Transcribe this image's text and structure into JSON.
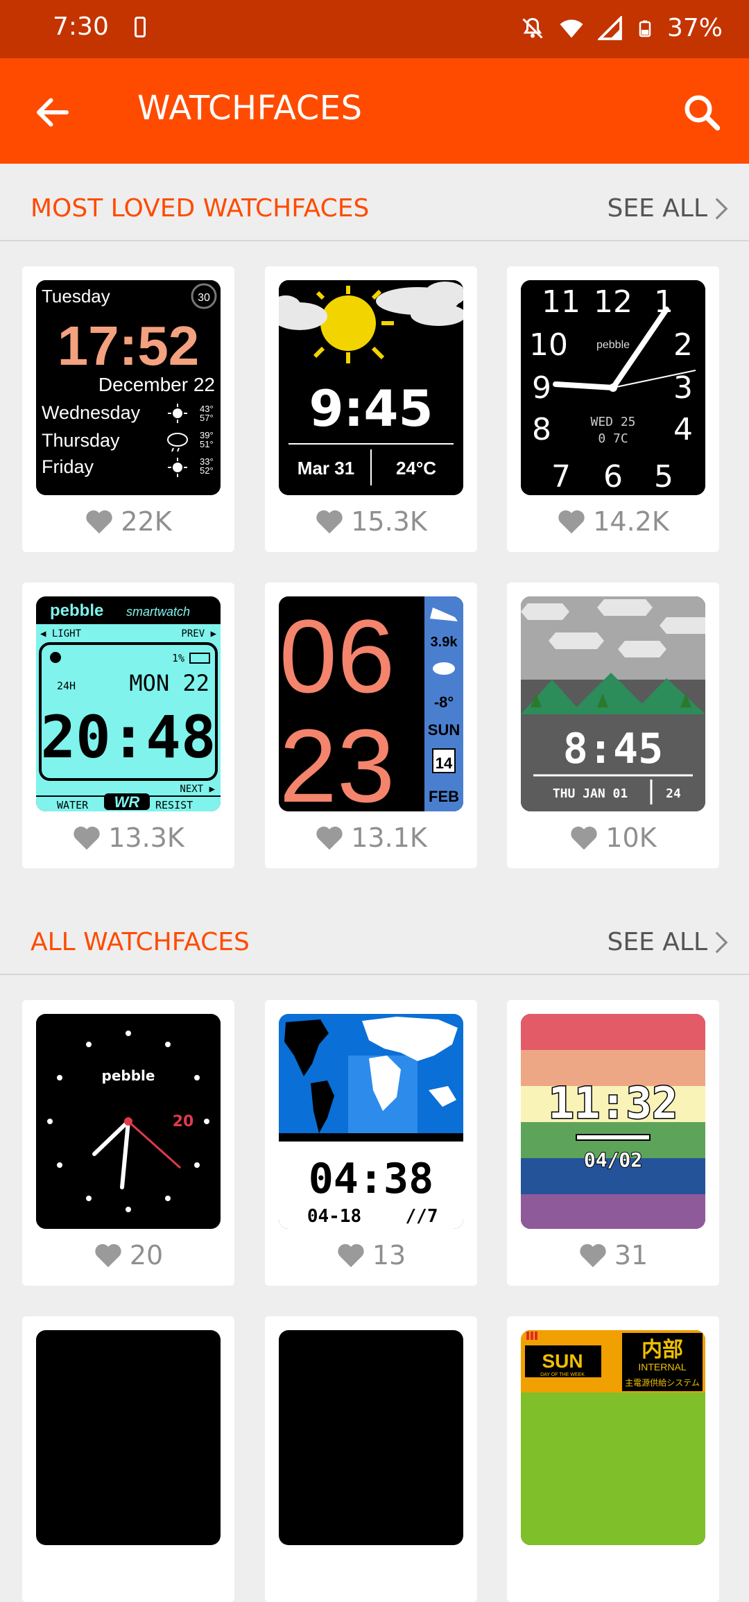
{
  "status_bar": {
    "time": "7:30",
    "battery": "37%"
  },
  "app_bar": {
    "title": "WATCHFACES",
    "back_icon": "arrow-left-icon",
    "search_icon": "search-icon"
  },
  "sections": [
    {
      "label": "MOST LOVED WATCHFACES",
      "see_all": "SEE ALL",
      "cards": [
        {
          "likes": "22K",
          "face": {
            "line1": "Tuesday",
            "time": "17:52",
            "date": "December 22",
            "d1": "Wednesday",
            "d2": "Thursday",
            "d3": "Friday",
            "badge": "30",
            "t1": "43°",
            "t1b": "57°",
            "t2": "39°",
            "t2b": "51°",
            "t3": "33°",
            "t3b": "52°"
          }
        },
        {
          "likes": "15.3K",
          "face": {
            "time": "9:45",
            "date": "Mar 31",
            "temp": "24°C"
          }
        },
        {
          "likes": "14.2K",
          "face": {
            "n12": "12",
            "n11": "11",
            "n1": "1",
            "n2": "2",
            "n3": "3",
            "n4": "4",
            "n5": "5",
            "n6": "6",
            "n7": "7",
            "n8": "8",
            "n9": "9",
            "n10": "10",
            "brand": "pebble",
            "date": "WED 25",
            "temp": "0 7C"
          }
        },
        {
          "likes": "13.3K",
          "face": {
            "brand": "pebble",
            "sub": "smartwatch",
            "light": "◀ LIGHT",
            "prev": "PREV ▶",
            "batt": "1%",
            "mode": "24H",
            "day": "MON 22",
            "time": "20:48",
            "next": "NEXT ▶",
            "water": "WATER",
            "wr": "WR",
            "resist": "RESIST"
          }
        },
        {
          "likes": "13.1K",
          "face": {
            "hour": "06",
            "min": "23",
            "steps": "3.9k",
            "temp": "-8°",
            "day": "SUN",
            "date": "14",
            "month": "FEB"
          }
        },
        {
          "likes": "10K",
          "face": {
            "time": "8:45",
            "date": "THU JAN 01",
            "num": "24"
          }
        }
      ]
    },
    {
      "label": "ALL WATCHFACES",
      "see_all": "SEE ALL",
      "cards": [
        {
          "likes": "20",
          "face": {
            "brand": "pebble",
            "sec": "20"
          }
        },
        {
          "likes": "13",
          "face": {
            "time": "04:38",
            "date": "04-18",
            "wd": "//7"
          }
        },
        {
          "likes": "31",
          "face": {
            "time": "11:32",
            "date": "04/02"
          }
        }
      ]
    }
  ],
  "partial_row": {
    "card3": {
      "sun": "SUN",
      "sun_sub": "DAY OF THE WEEK",
      "kanji": "内部",
      "internal": "INTERNAL",
      "jp": "主電源供給システム"
    }
  },
  "colors": {
    "accent": "#ff4b00",
    "status_bar": "#c43400",
    "background": "#eeeeee"
  }
}
